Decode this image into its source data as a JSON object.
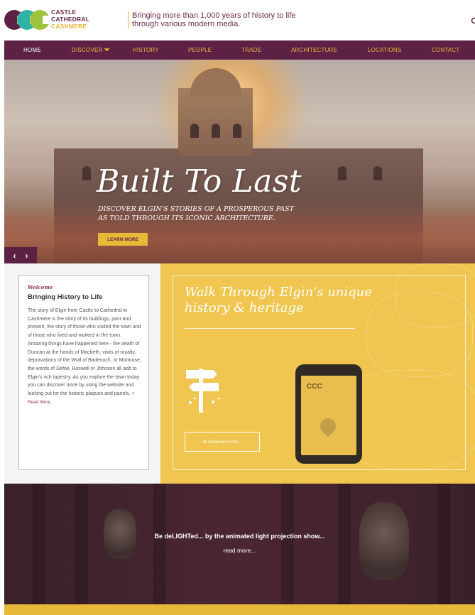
{
  "header": {
    "logo_line1": "CASTLE",
    "logo_line2": "CATHEDRAL",
    "logo_line3": "CASHMERE",
    "tagline": "Bringing more than 1,000 years of history to life through various modern media."
  },
  "nav": {
    "items": [
      {
        "label": "HOME",
        "active": true
      },
      {
        "label": "DISCOVER",
        "has_dropdown": true
      },
      {
        "label": "HISTORY"
      },
      {
        "label": "PEOPLE"
      },
      {
        "label": "TRADE"
      },
      {
        "label": "ARCHITECTURE"
      },
      {
        "label": "LOCATIONS"
      },
      {
        "label": "CONTACT"
      }
    ]
  },
  "hero": {
    "title": "Built To Last",
    "subtitle": "DISCOVER ELGIN'S STORIES OF A PROSPEROUS PAST AS TOLD THROUGH ITS ICONIC ARCHITECTURE.",
    "button": "LEARN MORE",
    "prev": "‹",
    "next": "›"
  },
  "welcome": {
    "label": "Welcome",
    "heading": "Bringing History to Life",
    "body": "The story of Elgin from Castle to Cathedral to Cashmere is the story of its buildings, past and present, the story of those who visited the town and of those who lived and worked in the town. Amazing things have happened here - the death of Duncan at the hands of Macbeth, visits of royalty, depravations of the Wolf of Badenoch, or Montrose, the words of Defoe, Boswell or Johnson all add to Elgin's rich tapestry. As you explore the town today you can discover more by using the website and looking out for the historic plaques and panels. +",
    "read_more": "Read More"
  },
  "walk": {
    "title": "Walk Through Elgin's unique history & heritage",
    "button": "⊕ Discover more...",
    "phone_logo": "CCC"
  },
  "light_show": {
    "title": "Be deLIGHTed... by the animated light projection show...",
    "link": "read more..."
  },
  "colors": {
    "plum": "#5c2145",
    "gold": "#e8b838",
    "walk_bg": "#f0c650",
    "teal": "#2fb3a4",
    "green": "#9cc33b"
  }
}
